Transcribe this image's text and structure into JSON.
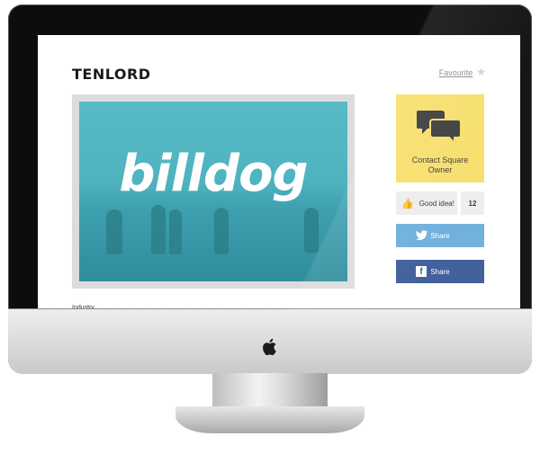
{
  "page": {
    "title": "TENLORD",
    "favourite_label": "Favourite",
    "favourite_icon": "star-icon"
  },
  "hero": {
    "logo_text": "billdog"
  },
  "section": {
    "industry_label": "Industry"
  },
  "sidebar": {
    "contact_label_line1": "Contact Square",
    "contact_label_line2": "Owner",
    "good_idea_label": "Good idea!",
    "good_idea_count": "12",
    "twitter_label": "Share",
    "facebook_label": "Share"
  },
  "colors": {
    "contact_bg": "#f7de6a",
    "twitter": "#6baedb",
    "facebook": "#3b5b98",
    "hero_teal": "#4fb3c0"
  }
}
